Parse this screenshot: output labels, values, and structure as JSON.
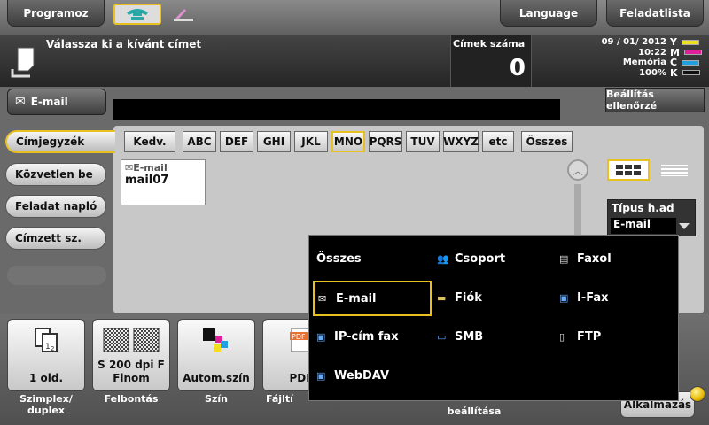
{
  "top": {
    "program_label": "Programoz",
    "language_label": "Language",
    "joblist_label": "Feladatlista",
    "mode_icons": [
      "fax-phone-icon",
      "scan-icon"
    ]
  },
  "message": {
    "text": "Válassza ki a kívánt címet",
    "cimek_label": "Címek száma",
    "cimek_count": "0",
    "date": "09 / 01/ 2012",
    "time": "10:22",
    "memory_label": "Memória",
    "memory_value": "100%",
    "toner": [
      "Y",
      "M",
      "C",
      "K"
    ],
    "toner_colors": [
      "#f0e020",
      "#e0209a",
      "#20a0e0",
      "#111111"
    ]
  },
  "header": {
    "email_tab": "E-mail",
    "beallitas": "Beállítás ellenőrzé"
  },
  "left_nav": {
    "items": [
      "Címjegyzék",
      "Közvetlen be",
      "Feladat napló",
      "Címzett sz."
    ]
  },
  "index_tabs": [
    "Kedv.",
    "ABC",
    "DEF",
    "GHI",
    "JKL",
    "MNO",
    "PQRS",
    "TUV",
    "WXYZ",
    "etc",
    "Összes"
  ],
  "selected_tab": "MNO",
  "address_card": {
    "type": "E-mail",
    "name": "mail07"
  },
  "type_filter": {
    "label": "Típus h.ad",
    "value": "E-mail"
  },
  "dropdown": {
    "items": [
      "Összes",
      "Csoport",
      "Faxol",
      "E-mail",
      "Fiók",
      "I-Fax",
      "IP-cím fax",
      "SMB",
      "FTP",
      "WebDAV"
    ],
    "selected": "E-mail"
  },
  "bottom": {
    "buttons": [
      {
        "value": "1 old.",
        "label": "Szimplex/ duplex"
      },
      {
        "value": "S 200 dpi F Finom",
        "label": "Felbontás"
      },
      {
        "value": "Autom.szín",
        "label": "Szín"
      },
      {
        "value": "PDF",
        "label": "Fájltí"
      }
    ],
    "extra_label": "beállítása",
    "right_button": "Alkalmazás"
  }
}
